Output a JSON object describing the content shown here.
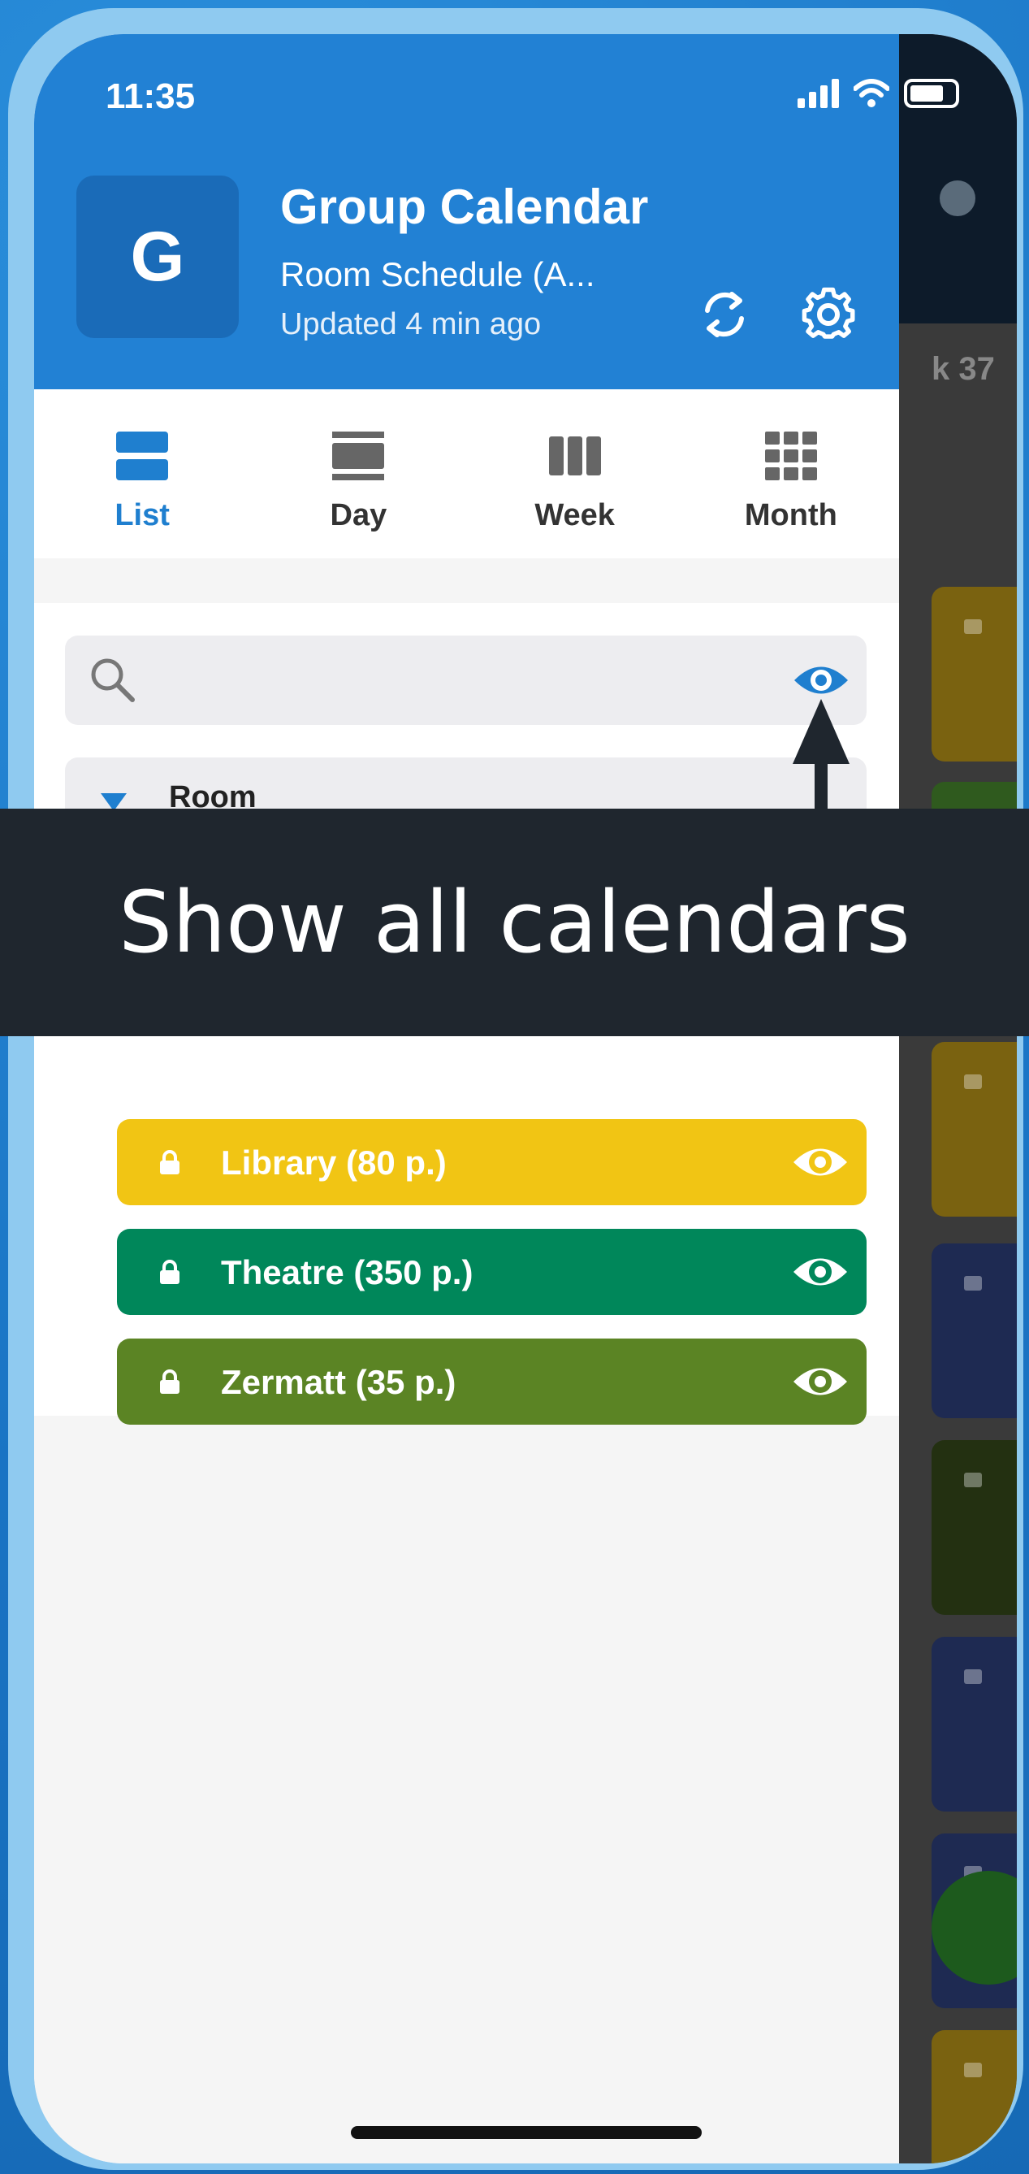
{
  "status": {
    "time": "11:35"
  },
  "header": {
    "avatar_letter": "G",
    "title": "Group Calendar",
    "subtitle": "Room Schedule (A...",
    "updated": "Updated 4 min ago"
  },
  "tabs": [
    {
      "label": "List",
      "active": true
    },
    {
      "label": "Day",
      "active": false
    },
    {
      "label": "Week",
      "active": false
    },
    {
      "label": "Month",
      "active": false
    }
  ],
  "group": {
    "label": "Room"
  },
  "calendars": [
    {
      "label": "Library (80 p.)",
      "color": "#f1c514"
    },
    {
      "label": "Theatre (350 p.)",
      "color": "#00875a"
    },
    {
      "label": "Zermatt (35 p.)",
      "color": "#5b8424"
    }
  ],
  "tooltip": {
    "text": "Show all calendars"
  },
  "background_app": {
    "week_label": "k 37"
  },
  "colors": {
    "accent": "#1f7fcf",
    "header": "#2281d4",
    "tooltip_bg": "#1f262e"
  }
}
